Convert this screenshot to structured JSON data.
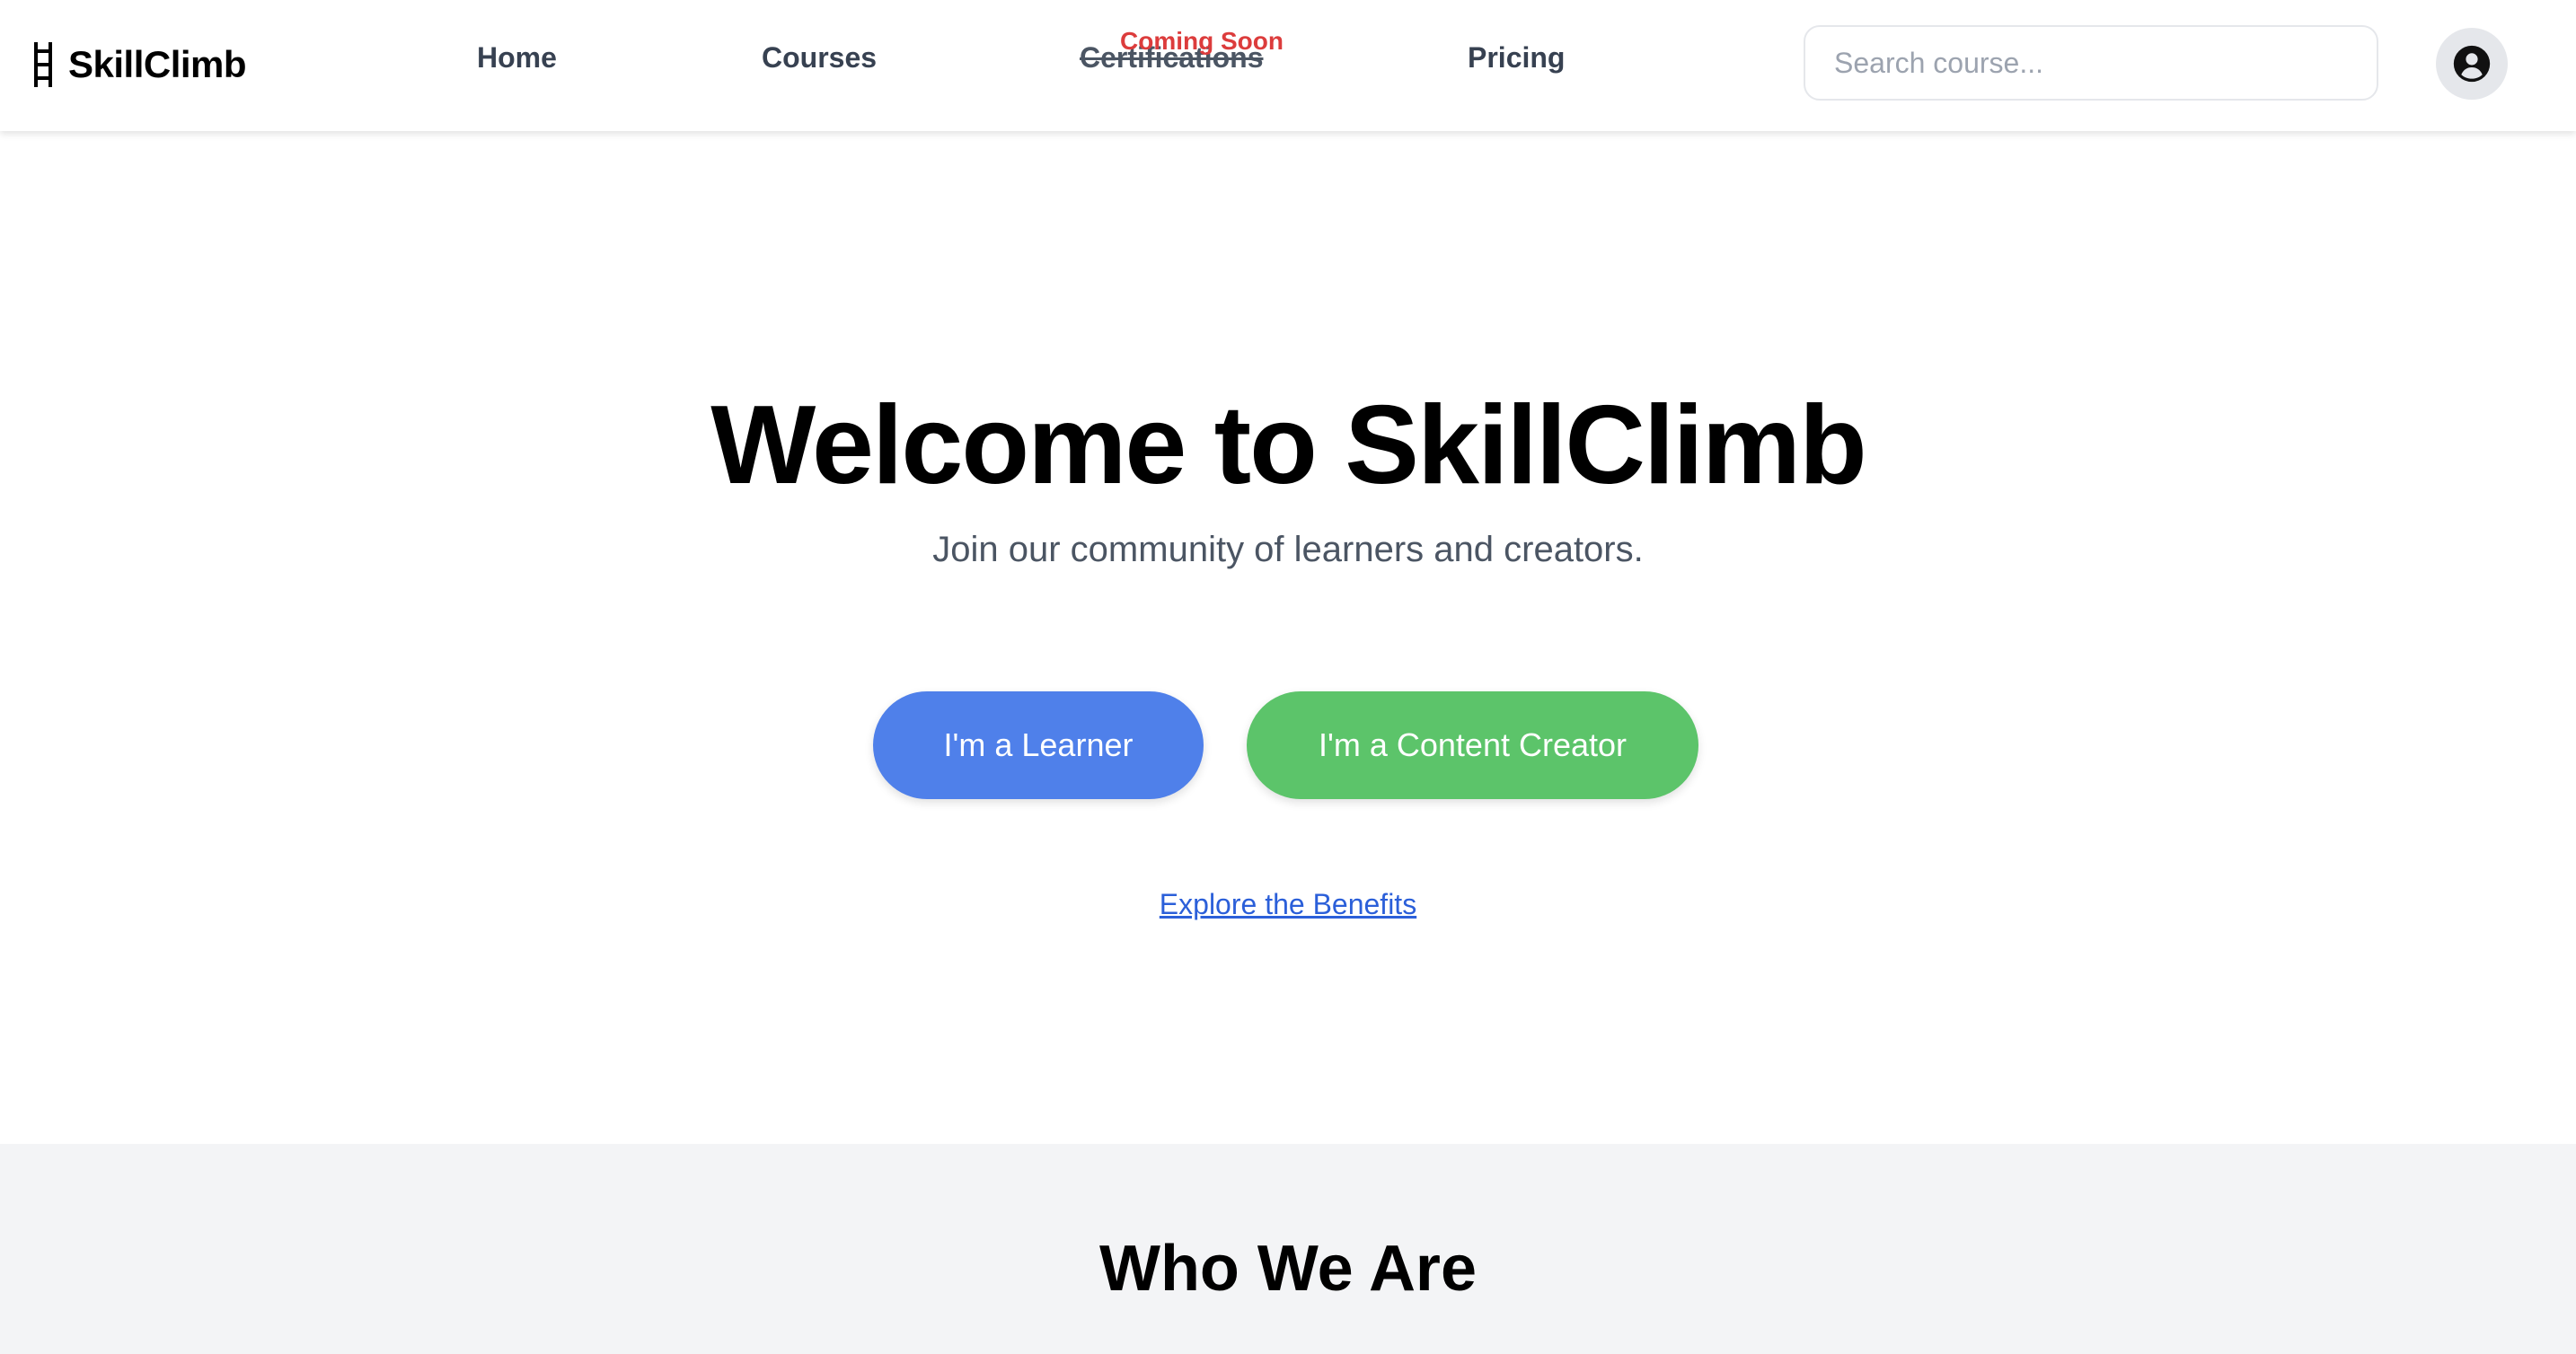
{
  "nav": {
    "brand": "SkillClimb",
    "brand_icon": "ladder-icon",
    "links": [
      {
        "label": "Home"
      },
      {
        "label": "Courses"
      },
      {
        "label": "Certifications",
        "badge": "Coming Soon",
        "disabled": true
      },
      {
        "label": "Pricing"
      }
    ],
    "search_placeholder": "Search course...",
    "avatar_icon": "user-circle-icon"
  },
  "hero": {
    "title": "Welcome to SkillClimb",
    "subtitle": "Join our community of learners and creators.",
    "learner_button": "I'm a Learner",
    "creator_button": "I'm a Content Creator",
    "explore_link": "Explore the Benefits"
  },
  "about": {
    "title": "Who We Are"
  },
  "colors": {
    "learner_button": "#4f80ea",
    "creator_button": "#5cc46a",
    "coming_soon": "#dc3c3c",
    "link": "#2b5fd9",
    "about_background": "#f3f4f6"
  }
}
